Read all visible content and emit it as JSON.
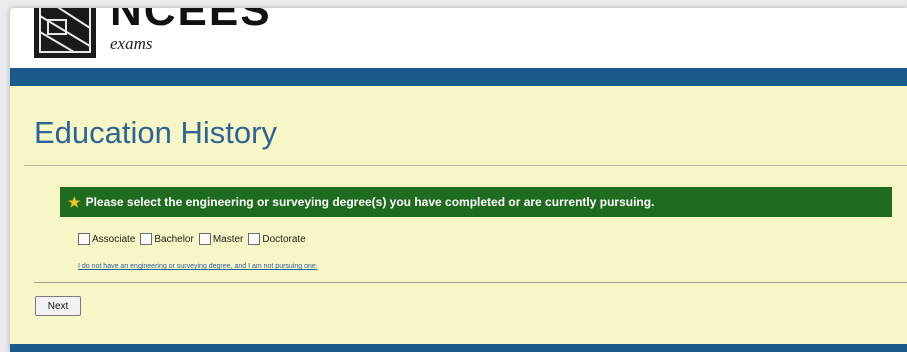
{
  "header": {
    "brand": "NCEES",
    "brand_sub": "exams"
  },
  "page": {
    "title": "Education History"
  },
  "notice": {
    "icon": "star-icon",
    "text": "Please select the engineering or surveying degree(s) you have completed or are currently pursuing."
  },
  "degrees": [
    {
      "label": "Associate",
      "checked": false
    },
    {
      "label": "Bachelor",
      "checked": false
    },
    {
      "label": "Master",
      "checked": false
    },
    {
      "label": "Doctorate",
      "checked": false
    }
  ],
  "no_degree_link": "I do not have an engineering or surveying degree, and I am not pursuing one.",
  "actions": {
    "next_label": "Next"
  },
  "colors": {
    "header_bar": "#1a5a8c",
    "content_bg": "#f7f6c6",
    "title": "#2e6496",
    "notice_bg": "#1f6b1f",
    "star": "#f3c52b",
    "link": "#2a5fa0"
  }
}
